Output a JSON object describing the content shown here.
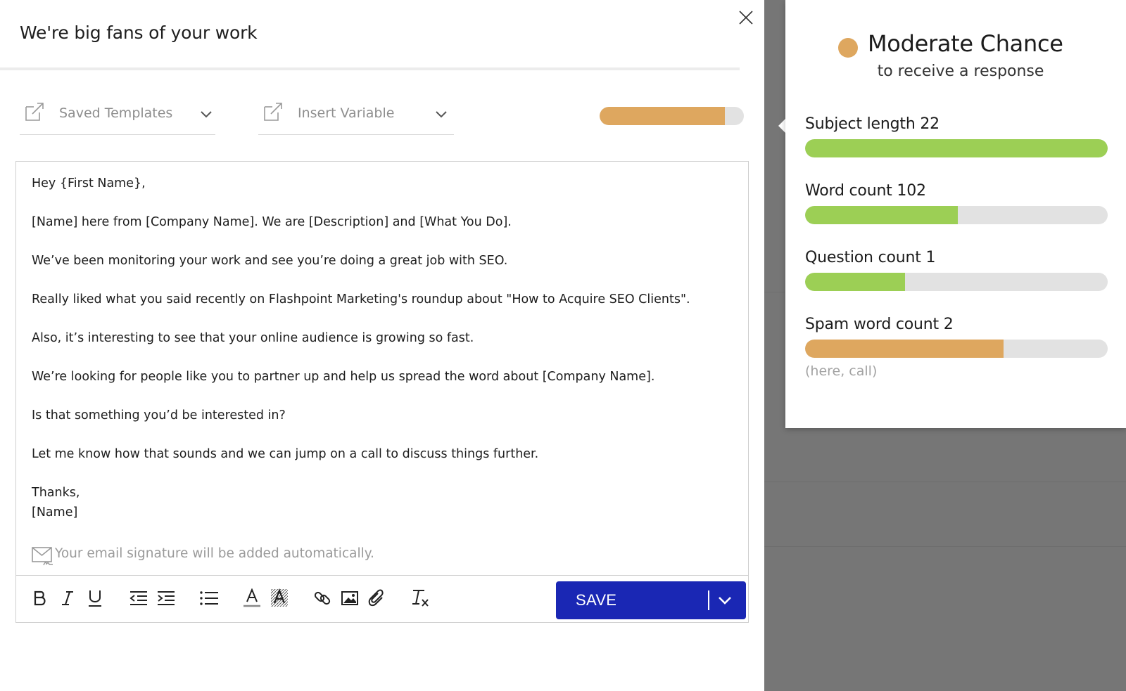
{
  "modal": {
    "title": "We're big fans of your work"
  },
  "toolbar_top": {
    "saved_templates_label": "Saved Templates",
    "insert_variable_label": "Insert Variable",
    "score_fraction": 0.87,
    "score_color": "#dea75f"
  },
  "email": {
    "lines": [
      "Hey {First Name},",
      "[Name] here from [Company Name]. We are [Description] and [What You Do].",
      "We’ve been monitoring your work and see you’re doing a great job with SEO.",
      "Really liked what you said recently on Flashpoint Marketing's roundup about \"How to Acquire SEO Clients\".",
      "Also, it’s interesting to see that your online audience is growing so fast.",
      "We’re looking for people like you to partner up and help us spread the word about [Company Name].",
      "Is that something you’d be interested in?",
      "Let me know how that sounds and we can jump on a call to discuss things further.",
      "Thanks,",
      "[Name]"
    ],
    "signature_note": "Your email signature will be added automatically."
  },
  "editor_toolbar": {
    "buttons": [
      "bold-icon",
      "italic-icon",
      "underline-icon",
      "outdent-icon",
      "indent-icon",
      "bullet-list-icon",
      "text-color-icon",
      "highlight-color-icon",
      "link-icon",
      "image-icon",
      "attachment-icon",
      "clear-format-icon"
    ],
    "save_label": "SAVE",
    "save_color": "#1a27b4"
  },
  "popover": {
    "chance_title": "Moderate Chance",
    "chance_subtitle": "to receive a response",
    "chance_color": "#dea75f",
    "metrics": [
      {
        "label": "Subject length 22",
        "fraction": 1.0,
        "color": "#9ccf55"
      },
      {
        "label": "Word count 102",
        "fraction": 0.505,
        "color": "#9ccf55"
      },
      {
        "label": "Question count 1",
        "fraction": 0.33,
        "color": "#9ccf55"
      },
      {
        "label": "Spam word count 2",
        "fraction": 0.655,
        "color": "#dea75f"
      }
    ],
    "spam_words": "(here, call)"
  }
}
